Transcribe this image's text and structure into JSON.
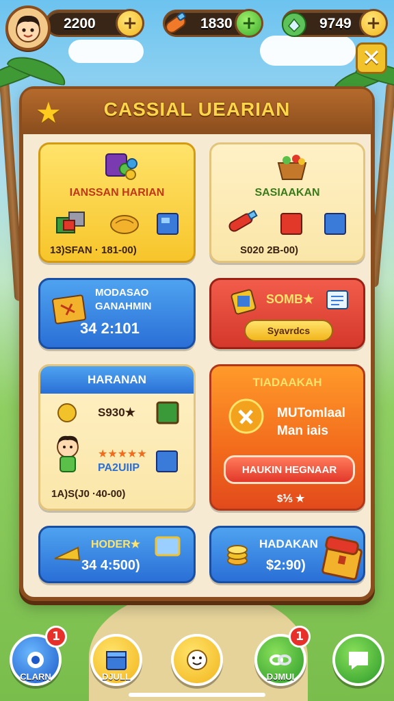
{
  "top_bar": {
    "resources": [
      {
        "name": "coins",
        "value": "2200",
        "icon": "coin-icon"
      },
      {
        "name": "energy",
        "value": "1830",
        "icon": "potion-icon"
      },
      {
        "name": "gems",
        "value": "9749",
        "icon": "gem-icon"
      }
    ],
    "close_icon": "close-icon"
  },
  "panel": {
    "title": "CASSIAL UEARIAN",
    "cards": [
      {
        "id": "card-1",
        "title": "IANSSAN HARIAN",
        "price": "13)SFAN · 181-00)"
      },
      {
        "id": "card-2",
        "title": "SASIAAKAN",
        "price": "S020 2B-00)"
      },
      {
        "id": "card-3",
        "title_line1": "MODASAO",
        "title_line2": "GANAHMIN",
        "price": "34 2:101"
      },
      {
        "id": "card-4",
        "title": "SOMB★",
        "button": "Syavrdcs"
      },
      {
        "id": "card-5",
        "title": "HARANAN",
        "sub1": "S930★",
        "sub2": "PA2UIIP",
        "price": "1A)S(J0 ·40-00)"
      },
      {
        "id": "card-6",
        "title": "TIADAAKAH",
        "line1": "MUTomlaal",
        "line2": "Man iais",
        "button": "HAUKIN HEGNAAR",
        "footer": "$⅕ ★"
      },
      {
        "id": "card-7",
        "title": "HODER★",
        "price": "34 4:500)"
      },
      {
        "id": "card-8",
        "title": "HADAKAN",
        "price": "$2:90)"
      }
    ]
  },
  "bottom_nav": [
    {
      "label": "CLARN",
      "badge": "1"
    },
    {
      "label": "DJULL",
      "badge": ""
    },
    {
      "label": "",
      "badge": ""
    },
    {
      "label": "DJMUI",
      "badge": "1"
    },
    {
      "label": "",
      "badge": ""
    }
  ]
}
